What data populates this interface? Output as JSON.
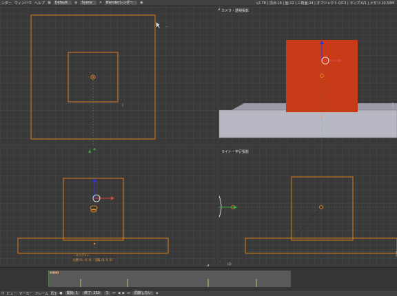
{
  "top_menu": [
    "ンダー",
    "ウィンドウ",
    "ヘルプ"
  ],
  "layout_select": "Default",
  "scene_select": "Scene",
  "engine_select": "Blenderレンダー",
  "stats": "v2.78 | 頂点:16 | 面:12 | 三角面:24 | オブジェクト:0/13 | ランプ:0/1 | メモリ:10.50M",
  "viewports": {
    "top_right_label": "カメラ・透視投影",
    "bottom_right_label": "ライト・平行投影",
    "bottom_left_info_name": "・エンプティ",
    "bottom_left_info_pos": "位置 (0, -4, 4) ・回転 (0, 0, 0)",
    "axis_label": "(1)"
  },
  "timeline": {
    "status_text": "▮▮▮▮▮▮"
  },
  "bottom_bar": {
    "items": [
      "ビュー",
      "マーカー",
      "フレーム",
      "再生"
    ],
    "start_label": "開始:",
    "start_value": "1",
    "end_label": "終了:",
    "end_value": "250",
    "current_value": "1",
    "sync_label": "同期しない",
    "keying": "◈"
  },
  "colors": {
    "selection_orange": "#ff8c1a",
    "cube_red": "#c83b18",
    "axis_red": "#c84040",
    "axis_green": "#3fa63f",
    "axis_blue": "#3030e0"
  }
}
